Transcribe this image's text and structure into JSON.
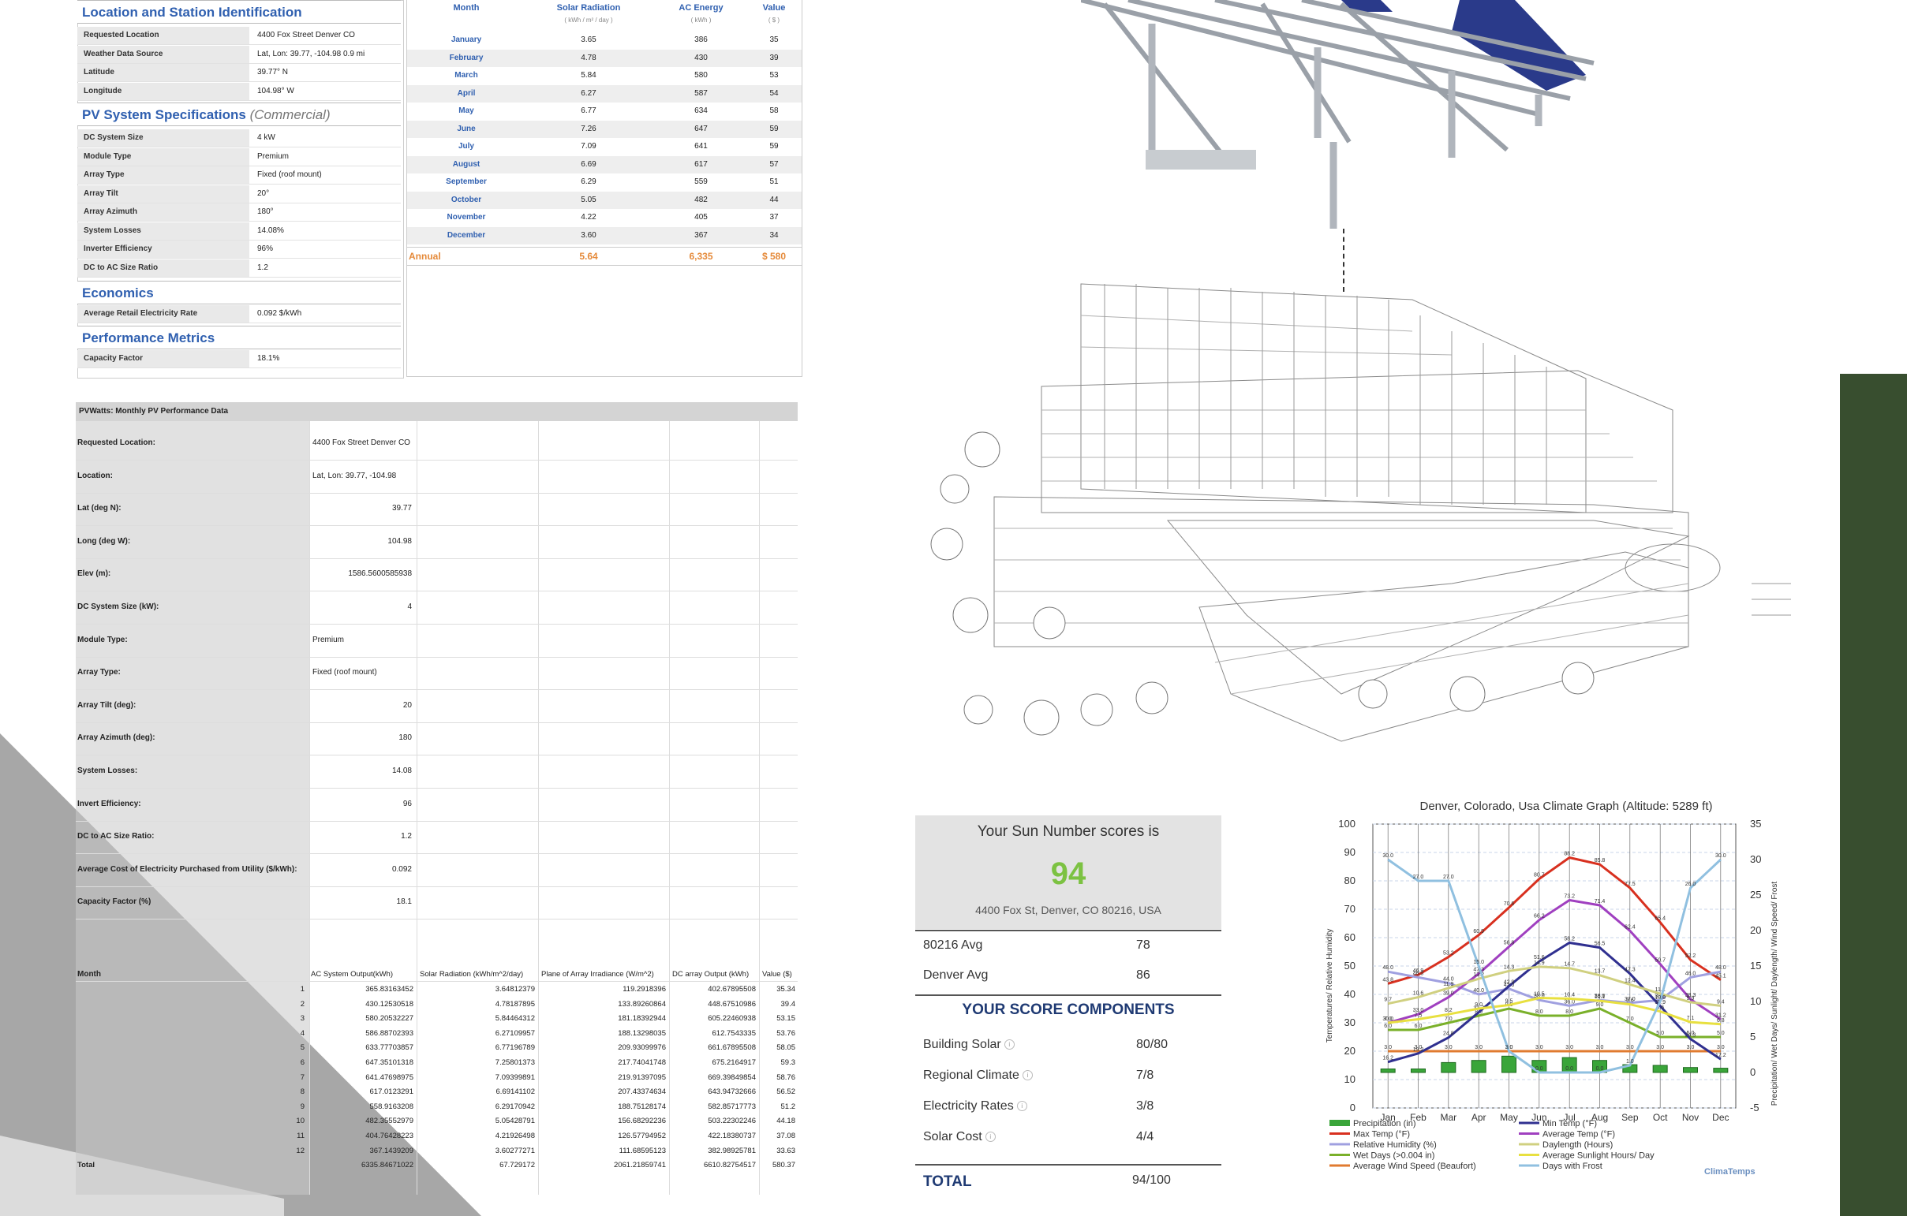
{
  "station": {
    "title": "Location and Station Identification",
    "rows": [
      {
        "k": "Requested Location",
        "v": "4400 Fox Street Denver CO"
      },
      {
        "k": "Weather Data Source",
        "v": "Lat, Lon: 39.77, -104.98     0.9 mi"
      },
      {
        "k": "Latitude",
        "v": "39.77° N"
      },
      {
        "k": "Longitude",
        "v": "104.98° W"
      }
    ]
  },
  "pv_specs": {
    "title": "PV System Specifications",
    "subtitle": "(Commercial)",
    "rows": [
      {
        "k": "DC System Size",
        "v": "4 kW"
      },
      {
        "k": "Module Type",
        "v": "Premium"
      },
      {
        "k": "Array Type",
        "v": "Fixed (roof mount)"
      },
      {
        "k": "Array Tilt",
        "v": "20°"
      },
      {
        "k": "Array Azimuth",
        "v": "180°"
      },
      {
        "k": "System Losses",
        "v": "14.08%"
      },
      {
        "k": "Inverter Efficiency",
        "v": "96%"
      },
      {
        "k": "DC to AC Size Ratio",
        "v": "1.2"
      }
    ]
  },
  "economics": {
    "title": "Economics",
    "rows": [
      {
        "k": "Average Retail Electricity Rate",
        "v": "0.092 $/kWh"
      }
    ]
  },
  "performance": {
    "title": "Performance Metrics",
    "rows": [
      {
        "k": "Capacity Factor",
        "v": "18.1%"
      }
    ]
  },
  "monthly_summary": {
    "headers": {
      "month": "Month",
      "solar": "Solar Radiation",
      "solar_unit": "( kWh / m² / day )",
      "ac": "AC Energy",
      "ac_unit": "( kWh )",
      "value": "Value",
      "value_unit": "( $ )"
    },
    "rows": [
      {
        "m": "January",
        "sr": "3.65",
        "ac": "386",
        "vl": "35"
      },
      {
        "m": "February",
        "sr": "4.78",
        "ac": "430",
        "vl": "39"
      },
      {
        "m": "March",
        "sr": "5.84",
        "ac": "580",
        "vl": "53"
      },
      {
        "m": "April",
        "sr": "6.27",
        "ac": "587",
        "vl": "54"
      },
      {
        "m": "May",
        "sr": "6.77",
        "ac": "634",
        "vl": "58"
      },
      {
        "m": "June",
        "sr": "7.26",
        "ac": "647",
        "vl": "59"
      },
      {
        "m": "July",
        "sr": "7.09",
        "ac": "641",
        "vl": "59"
      },
      {
        "m": "August",
        "sr": "6.69",
        "ac": "617",
        "vl": "57"
      },
      {
        "m": "September",
        "sr": "6.29",
        "ac": "559",
        "vl": "51"
      },
      {
        "m": "October",
        "sr": "5.05",
        "ac": "482",
        "vl": "44"
      },
      {
        "m": "November",
        "sr": "4.22",
        "ac": "405",
        "vl": "37"
      },
      {
        "m": "December",
        "sr": "3.60",
        "ac": "367",
        "vl": "34"
      }
    ],
    "annual": {
      "label": "Annual",
      "sr": "5.64",
      "ac": "6,335",
      "vl": "$ 580"
    }
  },
  "pvwatts": {
    "title": "PVWatts: Monthly PV Performance Data",
    "params": [
      {
        "k": "Requested Location:",
        "v": "4400 Fox Street Denver CO",
        "align": "left"
      },
      {
        "k": "Location:",
        "v": "Lat, Lon: 39.77, -104.98",
        "align": "left"
      },
      {
        "k": "Lat (deg N):",
        "v": "39.77",
        "align": "right"
      },
      {
        "k": "Long (deg W):",
        "v": "104.98",
        "align": "right"
      },
      {
        "k": "Elev (m):",
        "v": "1586.5600585938",
        "align": "right"
      },
      {
        "k": "DC System Size (kW):",
        "v": "4",
        "align": "right"
      },
      {
        "k": "Module Type:",
        "v": "Premium",
        "align": "left"
      },
      {
        "k": "Array Type:",
        "v": "Fixed (roof mount)",
        "align": "left"
      },
      {
        "k": "Array Tilt (deg):",
        "v": "20",
        "align": "right"
      },
      {
        "k": "Array Azimuth (deg):",
        "v": "180",
        "align": "right"
      },
      {
        "k": "System Losses:",
        "v": "14.08",
        "align": "right"
      },
      {
        "k": "Invert Efficiency:",
        "v": "96",
        "align": "right"
      },
      {
        "k": "DC to AC Size Ratio:",
        "v": "1.2",
        "align": "right"
      },
      {
        "k": "Average Cost of Electricity Purchased from Utility ($/kWh):",
        "v": "0.092",
        "align": "right"
      },
      {
        "k": "Capacity Factor (%)",
        "v": "18.1",
        "align": "right"
      }
    ],
    "columns": [
      "Month",
      "AC System Output(kWh)",
      "Solar Radiation (kWh/m^2/day)",
      "Plane of Array Irradiance (W/m^2)",
      "DC array Output (kWh)",
      "Value ($)"
    ],
    "rows": [
      [
        "1",
        "365.83163452",
        "3.64812379",
        "119.2918396",
        "402.67895508",
        "35.34"
      ],
      [
        "2",
        "430.12530518",
        "4.78187895",
        "133.89260864",
        "448.67510986",
        "39.4"
      ],
      [
        "3",
        "580.20532227",
        "5.84464312",
        "181.18392944",
        "605.22460938",
        "53.15"
      ],
      [
        "4",
        "586.88702393",
        "6.27109957",
        "188.13298035",
        "612.7543335",
        "53.76"
      ],
      [
        "5",
        "633.77703857",
        "6.77196789",
        "209.93099976",
        "661.67895508",
        "58.05"
      ],
      [
        "6",
        "647.35101318",
        "7.25801373",
        "217.74041748",
        "675.2164917",
        "59.3"
      ],
      [
        "7",
        "641.47698975",
        "7.09399891",
        "219.91397095",
        "669.39849854",
        "58.76"
      ],
      [
        "8",
        "617.0123291",
        "6.69141102",
        "207.43374634",
        "643.94732666",
        "56.52"
      ],
      [
        "9",
        "558.9163208",
        "6.29170942",
        "188.75128174",
        "582.85717773",
        "51.2"
      ],
      [
        "10",
        "482.35552979",
        "5.05428791",
        "156.68292236",
        "503.22302246",
        "44.18"
      ],
      [
        "11",
        "404.76428223",
        "4.21926498",
        "126.57794952",
        "422.18380737",
        "37.08"
      ],
      [
        "12",
        "367.1439209",
        "3.60277271",
        "111.68595123",
        "382.98925781",
        "33.63"
      ]
    ],
    "total": [
      "Total",
      "6335.84671022",
      "67.729172",
      "2061.21859741",
      "6610.82754517",
      "580.37"
    ]
  },
  "score": {
    "heading": "Your Sun Number scores is",
    "value": "94",
    "address": "4400 Fox St, Denver, CO 80216, USA",
    "avgs": [
      {
        "label": "80216 Avg",
        "value": "78"
      },
      {
        "label": "Denver Avg",
        "value": "86"
      }
    ],
    "components_title": "YOUR SCORE COMPONENTS",
    "components": [
      {
        "label": "Building Solar",
        "value": "80/80"
      },
      {
        "label": "Regional Climate",
        "value": "7/8"
      },
      {
        "label": "Electricity Rates",
        "value": "3/8"
      },
      {
        "label": "Solar Cost",
        "value": "4/4"
      }
    ],
    "total_label": "TOTAL",
    "total_value": "94/100",
    "accent": "#7cc242"
  },
  "chart_data": {
    "type": "line",
    "title": "Denver, Colorado, Usa Climate Graph (Altitude: 5289 ft)",
    "ylabel": "Temperatures/ Relative Humidity",
    "y2label": "Precipitation/ Wet Days/ Sunlight/ Daylength/ Wind Speed/ Frost",
    "categories": [
      "Jan",
      "Feb",
      "Mar",
      "Apr",
      "May",
      "Jun",
      "Jul",
      "Aug",
      "Sep",
      "Oct",
      "Nov",
      "Dec"
    ],
    "ylim": [
      0,
      100
    ],
    "y2lim": [
      -5,
      35
    ],
    "yticks": [
      0,
      10,
      20,
      30,
      40,
      50,
      60,
      70,
      80,
      90,
      100
    ],
    "y2ticks": [
      -5,
      0,
      5,
      10,
      15,
      20,
      25,
      30,
      35
    ],
    "series": [
      {
        "name": "Precipitation (in)",
        "kind": "bar",
        "axis": "right",
        "color": "#3aa53a",
        "values": [
          0.5,
          0.5,
          1.4,
          1.7,
          2.3,
          1.7,
          2.1,
          1.7,
          1.1,
          1.0,
          0.7,
          0.6
        ]
      },
      {
        "name": "Max Temp (°F)",
        "axis": "left",
        "color": "#d8301f",
        "values": [
          43.8,
          46.9,
          53.2,
          60.9,
          70.6,
          80.7,
          88.2,
          85.8,
          77.5,
          65.4,
          52.2,
          45.1
        ]
      },
      {
        "name": "Relative Humidity (%)",
        "axis": "left",
        "color": "#a0a0e0",
        "values": [
          48,
          46,
          44,
          40,
          42,
          38,
          36,
          38,
          37,
          38,
          46,
          48
        ]
      },
      {
        "name": "Wet Days (>0.004 in)",
        "axis": "right",
        "color": "#7ab02a",
        "values": [
          6.0,
          6.0,
          7.0,
          8.0,
          9.0,
          8.0,
          8.0,
          9.0,
          7.0,
          5.0,
          5.0,
          5.0
        ]
      },
      {
        "name": "Average Wind Speed (Beaufort)",
        "axis": "right",
        "color": "#e07b30",
        "values": [
          3.0,
          3.0,
          3.0,
          3.0,
          3.0,
          3.0,
          3.0,
          3.0,
          3.0,
          3.0,
          3.0,
          3.0
        ]
      },
      {
        "name": "Min Temp (°F)",
        "axis": "left",
        "color": "#303090",
        "values": [
          16.2,
          19.2,
          24.8,
          33.7,
          42.9,
          51.6,
          58.2,
          56.5,
          47.3,
          35.9,
          24.3,
          17.2
        ]
      },
      {
        "name": "Average Temp (°F)",
        "axis": "left",
        "color": "#a040c0",
        "values": [
          30.0,
          33.0,
          39.0,
          47.3,
          56.8,
          66.2,
          73.2,
          71.4,
          62.4,
          50.7,
          38.3,
          31.2
        ]
      },
      {
        "name": "Daylength (Hours)",
        "axis": "right",
        "color": "#d0d080",
        "values": [
          9.7,
          10.6,
          11.9,
          13.2,
          14.3,
          14.9,
          14.7,
          13.7,
          12.4,
          11.1,
          9.9,
          9.4
        ]
      },
      {
        "name": "Average Sunlight Hours/ Day",
        "axis": "right",
        "color": "#e8e040",
        "values": [
          7.0,
          7.5,
          8.2,
          9.0,
          9.5,
          10.5,
          10.4,
          10.1,
          9.6,
          8.6,
          7.1,
          6.8
        ]
      },
      {
        "name": "Days with Frost",
        "axis": "right",
        "color": "#90c0e0",
        "values": [
          30.0,
          27.0,
          27.0,
          15.0,
          3.0,
          0.0,
          0.0,
          0.0,
          1.0,
          10.0,
          26.0,
          30.0
        ]
      }
    ],
    "logo": "ClimaTemps",
    "grid": true,
    "legend_position": "bottom"
  },
  "colors": {
    "blue_heading": "#3060b0",
    "orange_annual": "#e58a3a",
    "green_bar": "#384e2f"
  }
}
